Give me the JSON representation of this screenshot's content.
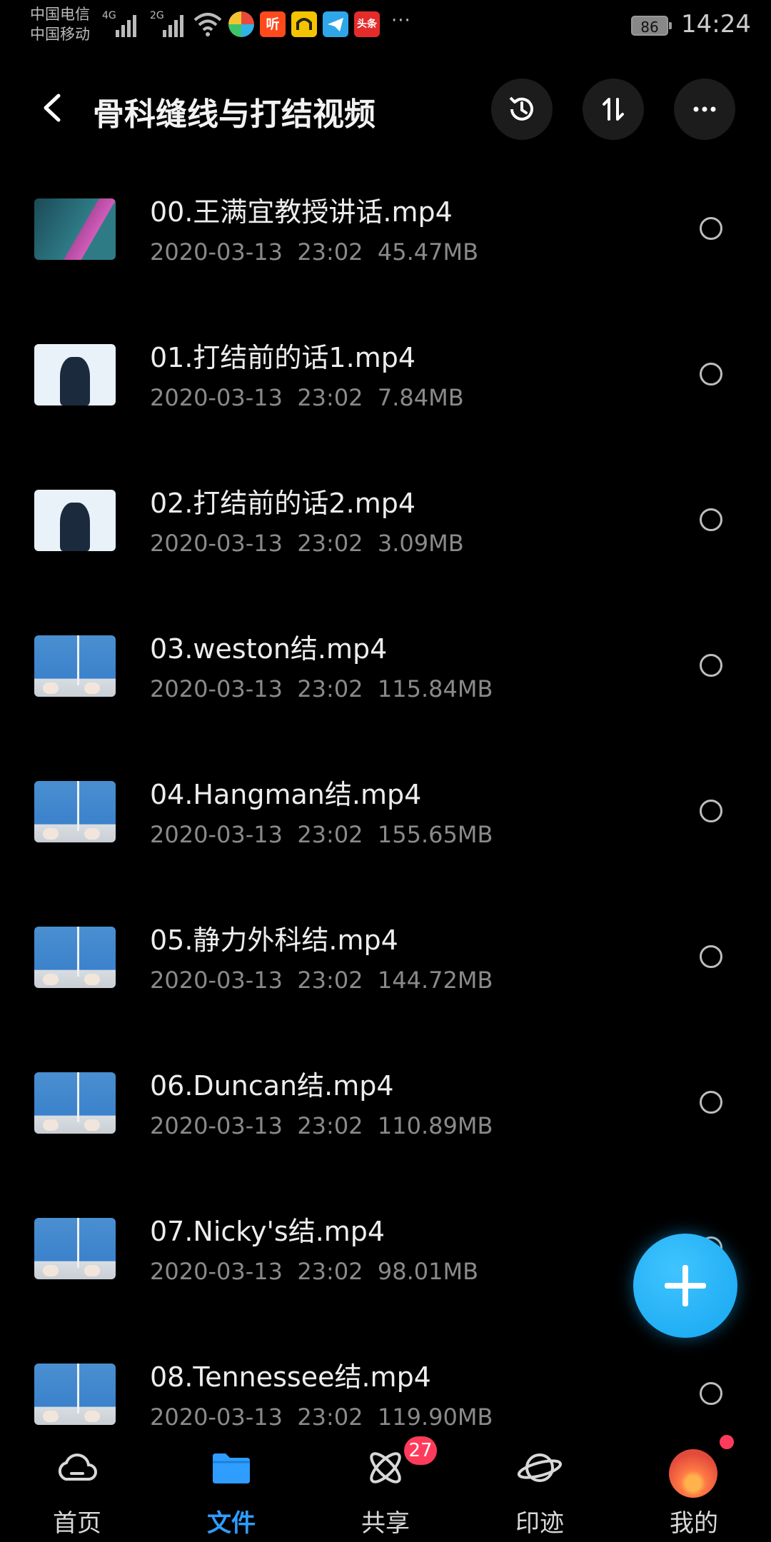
{
  "status_bar": {
    "carrier1": "中国电信",
    "carrier2": "中国移动",
    "network1": "4G",
    "network2": "2G",
    "app_icons": [
      "colorful-app-icon",
      "ting-app-icon",
      "yellow-app-icon",
      "telegram-icon",
      "toutiao-icon"
    ],
    "ting_label": "听",
    "toutiao_label": "头条",
    "more": "···",
    "battery": "86",
    "time": "14:24"
  },
  "header": {
    "title": "骨科缝线与打结视频"
  },
  "files": [
    {
      "name": "00.王满宜教授讲话.mp4",
      "date": "2020-03-13",
      "time": "23:02",
      "size": "45.47MB",
      "thumb": "slide"
    },
    {
      "name": "01.打结前的话1.mp4",
      "date": "2020-03-13",
      "time": "23:02",
      "size": "7.84MB",
      "thumb": "white"
    },
    {
      "name": "02.打结前的话2.mp4",
      "date": "2020-03-13",
      "time": "23:02",
      "size": "3.09MB",
      "thumb": "white"
    },
    {
      "name": "03.weston结.mp4",
      "date": "2020-03-13",
      "time": "23:02",
      "size": "115.84MB",
      "thumb": "blue"
    },
    {
      "name": "04.Hangman结.mp4",
      "date": "2020-03-13",
      "time": "23:02",
      "size": "155.65MB",
      "thumb": "blue"
    },
    {
      "name": "05.静力外科结.mp4",
      "date": "2020-03-13",
      "time": "23:02",
      "size": "144.72MB",
      "thumb": "blue"
    },
    {
      "name": "06.Duncan结.mp4",
      "date": "2020-03-13",
      "time": "23:02",
      "size": "110.89MB",
      "thumb": "blue"
    },
    {
      "name": "07.Nicky's结.mp4",
      "date": "2020-03-13",
      "time": "23:02",
      "size": "98.01MB",
      "thumb": "blue"
    },
    {
      "name": "08.Tennessee结.mp4",
      "date": "2020-03-13",
      "time": "23:02",
      "size": "119.90MB",
      "thumb": "blue"
    }
  ],
  "bottom_nav": {
    "items": [
      {
        "label": "首页",
        "icon": "cloud-icon",
        "active": false
      },
      {
        "label": "文件",
        "icon": "folder-icon",
        "active": true
      },
      {
        "label": "共享",
        "icon": "share-atom-icon",
        "active": false
      },
      {
        "label": "印迹",
        "icon": "planet-icon",
        "active": false
      },
      {
        "label": "我的",
        "icon": "avatar",
        "active": false
      }
    ],
    "share_badge": "27"
  },
  "colors": {
    "accent": "#2f9dff",
    "fab": "#16a6f0",
    "badge": "#ff3b5c",
    "background": "#000000"
  }
}
